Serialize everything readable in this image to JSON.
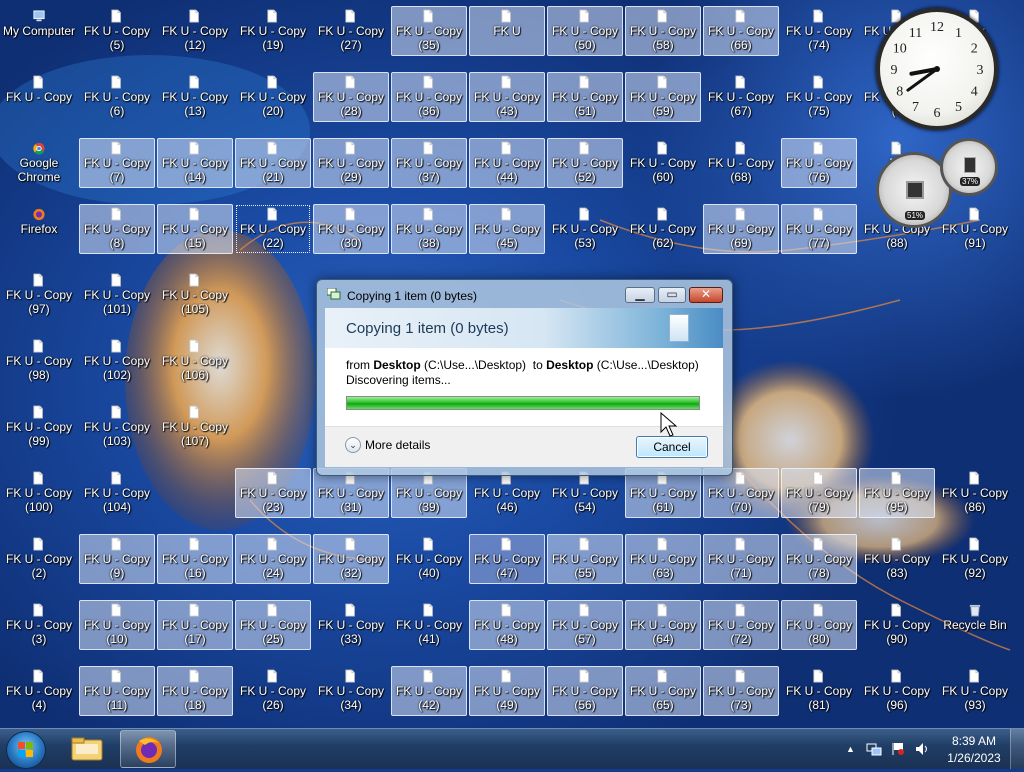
{
  "desktop": {
    "icon_type_names": {
      "computer": "computer-icon",
      "browser-chrome": "chrome-icon",
      "browser-firefox": "firefox-icon",
      "file": "file-icon",
      "bin": "recycle-bin-icon"
    },
    "columns": [
      {
        "items": [
          {
            "label": "My Computer",
            "type": "computer"
          },
          {
            "label": "FK U - Copy",
            "type": "file"
          },
          {
            "label": "Google Chrome",
            "type": "browser-chrome"
          },
          {
            "label": "Firefox",
            "type": "browser-firefox"
          },
          {
            "label": "FK U - Copy (97)",
            "type": "file"
          },
          {
            "label": "FK U - Copy (98)",
            "type": "file"
          },
          {
            "label": "FK U - Copy (99)",
            "type": "file"
          },
          {
            "label": "FK U - Copy (100)",
            "type": "file"
          },
          {
            "label": "FK U - Copy (2)",
            "type": "file"
          },
          {
            "label": "FK U - Copy (3)",
            "type": "file"
          },
          {
            "label": "FK U - Copy (4)",
            "type": "file"
          }
        ]
      },
      {
        "items": [
          {
            "label": "FK U - Copy (5)",
            "type": "file"
          },
          {
            "label": "FK U - Copy (6)",
            "type": "file"
          },
          {
            "label": "FK U - Copy (7)",
            "type": "file",
            "sel": true
          },
          {
            "label": "FK U - Copy (8)",
            "type": "file",
            "sel": true
          },
          {
            "label": "FK U - Copy (101)",
            "type": "file"
          },
          {
            "label": "FK U - Copy (102)",
            "type": "file"
          },
          {
            "label": "FK U - Copy (103)",
            "type": "file"
          },
          {
            "label": "FK U - Copy (104)",
            "type": "file"
          },
          {
            "label": "FK U - Copy (9)",
            "type": "file",
            "sel": true
          },
          {
            "label": "FK U - Copy (10)",
            "type": "file",
            "sel": true
          },
          {
            "label": "FK U - Copy (11)",
            "type": "file",
            "sel": true
          }
        ]
      },
      {
        "items": [
          {
            "label": "FK U - Copy (12)",
            "type": "file"
          },
          {
            "label": "FK U - Copy (13)",
            "type": "file"
          },
          {
            "label": "FK U - Copy (14)",
            "type": "file",
            "sel": true
          },
          {
            "label": "FK U - Copy (15)",
            "type": "file",
            "sel": true
          },
          {
            "label": "FK U - Copy (105)",
            "type": "file"
          },
          {
            "label": "FK U - Copy (106)",
            "type": "file"
          },
          {
            "label": "FK U - Copy (107)",
            "type": "file"
          },
          {
            "label": "",
            "type": "none"
          },
          {
            "label": "FK U - Copy (16)",
            "type": "file",
            "sel": true
          },
          {
            "label": "FK U - Copy (17)",
            "type": "file",
            "sel": true
          },
          {
            "label": "FK U - Copy (18)",
            "type": "file",
            "sel": true
          }
        ]
      },
      {
        "items": [
          {
            "label": "FK U - Copy (19)",
            "type": "file"
          },
          {
            "label": "FK U - Copy (20)",
            "type": "file"
          },
          {
            "label": "FK U - Copy (21)",
            "type": "file",
            "sel": true
          },
          {
            "label": "FK U - Copy (22)",
            "type": "file",
            "focus": true
          },
          {
            "label": "",
            "type": "none"
          },
          {
            "label": "",
            "type": "none"
          },
          {
            "label": "",
            "type": "none"
          },
          {
            "label": "FK U - Copy (23)",
            "type": "file",
            "sel": true
          },
          {
            "label": "FK U - Copy (24)",
            "type": "file",
            "sel": true
          },
          {
            "label": "FK U - Copy (25)",
            "type": "file",
            "sel": true
          },
          {
            "label": "FK U - Copy (26)",
            "type": "file"
          }
        ]
      },
      {
        "items": [
          {
            "label": "FK U - Copy (27)",
            "type": "file"
          },
          {
            "label": "FK U - Copy (28)",
            "type": "file",
            "sel": true
          },
          {
            "label": "FK U - Copy (29)",
            "type": "file",
            "sel": true
          },
          {
            "label": "FK U - Copy (30)",
            "type": "file",
            "sel": true
          },
          {
            "label": "",
            "type": "none"
          },
          {
            "label": "",
            "type": "none"
          },
          {
            "label": "",
            "type": "none"
          },
          {
            "label": "FK U - Copy (31)",
            "type": "file",
            "sel": true
          },
          {
            "label": "FK U - Copy (32)",
            "type": "file",
            "sel": true
          },
          {
            "label": "FK U - Copy (33)",
            "type": "file"
          },
          {
            "label": "FK U - Copy (34)",
            "type": "file"
          }
        ]
      },
      {
        "items": [
          {
            "label": "FK U - Copy (35)",
            "type": "file",
            "sel": true
          },
          {
            "label": "FK U - Copy (36)",
            "type": "file",
            "sel": true
          },
          {
            "label": "FK U - Copy (37)",
            "type": "file",
            "sel": true
          },
          {
            "label": "FK U - Copy (38)",
            "type": "file",
            "sel": true
          },
          {
            "label": "",
            "type": "none"
          },
          {
            "label": "",
            "type": "none"
          },
          {
            "label": "",
            "type": "none"
          },
          {
            "label": "FK U - Copy (39)",
            "type": "file",
            "sel": true
          },
          {
            "label": "FK U - Copy (40)",
            "type": "file"
          },
          {
            "label": "FK U - Copy (41)",
            "type": "file"
          },
          {
            "label": "FK U - Copy (42)",
            "type": "file",
            "sel": true
          }
        ]
      },
      {
        "items": [
          {
            "label": "FK U",
            "type": "file",
            "sel": true
          },
          {
            "label": "FK U - Copy (43)",
            "type": "file",
            "sel": true
          },
          {
            "label": "FK U - Copy (44)",
            "type": "file",
            "sel": true
          },
          {
            "label": "FK U - Copy (45)",
            "type": "file",
            "sel": true
          },
          {
            "label": "",
            "type": "none"
          },
          {
            "label": "",
            "type": "none"
          },
          {
            "label": "",
            "type": "none"
          },
          {
            "label": "FK U - Copy (46)",
            "type": "file"
          },
          {
            "label": "FK U - Copy (47)",
            "type": "file",
            "hl": true
          },
          {
            "label": "FK U - Copy (48)",
            "type": "file",
            "sel": true
          },
          {
            "label": "FK U - Copy (49)",
            "type": "file",
            "sel": true
          }
        ]
      },
      {
        "items": [
          {
            "label": "FK U - Copy (50)",
            "type": "file",
            "sel": true
          },
          {
            "label": "FK U - Copy (51)",
            "type": "file",
            "sel": true
          },
          {
            "label": "FK U - Copy (52)",
            "type": "file",
            "sel": true
          },
          {
            "label": "FK U - Copy (53)",
            "type": "file"
          },
          {
            "label": "",
            "type": "none"
          },
          {
            "label": "",
            "type": "none"
          },
          {
            "label": "",
            "type": "none"
          },
          {
            "label": "FK U - Copy (54)",
            "type": "file"
          },
          {
            "label": "FK U - Copy (55)",
            "type": "file",
            "sel": true
          },
          {
            "label": "FK U - Copy (57)",
            "type": "file",
            "sel": true
          },
          {
            "label": "FK U - Copy (56)",
            "type": "file",
            "sel": true
          }
        ]
      },
      {
        "items": [
          {
            "label": "FK U - Copy (58)",
            "type": "file",
            "sel": true
          },
          {
            "label": "FK U - Copy (59)",
            "type": "file",
            "sel": true
          },
          {
            "label": "FK U - Copy (60)",
            "type": "file"
          },
          {
            "label": "FK U - Copy (62)",
            "type": "file"
          },
          {
            "label": "",
            "type": "none"
          },
          {
            "label": "",
            "type": "none"
          },
          {
            "label": "",
            "type": "none"
          },
          {
            "label": "FK U - Copy (61)",
            "type": "file",
            "sel": true
          },
          {
            "label": "FK U - Copy (63)",
            "type": "file",
            "sel": true
          },
          {
            "label": "FK U - Copy (64)",
            "type": "file",
            "sel": true
          },
          {
            "label": "FK U - Copy (65)",
            "type": "file",
            "sel": true
          }
        ]
      },
      {
        "items": [
          {
            "label": "FK U - Copy (66)",
            "type": "file",
            "sel": true
          },
          {
            "label": "FK U - Copy (67)",
            "type": "file"
          },
          {
            "label": "FK U - Copy (68)",
            "type": "file"
          },
          {
            "label": "FK U - Copy (69)",
            "type": "file",
            "sel": true
          },
          {
            "label": "",
            "type": "none"
          },
          {
            "label": "",
            "type": "none"
          },
          {
            "label": "",
            "type": "none"
          },
          {
            "label": "FK U - Copy (70)",
            "type": "file",
            "sel": true
          },
          {
            "label": "FK U - Copy (71)",
            "type": "file",
            "sel": true
          },
          {
            "label": "FK U - Copy (72)",
            "type": "file",
            "sel": true
          },
          {
            "label": "FK U - Copy (73)",
            "type": "file",
            "sel": true
          }
        ]
      },
      {
        "items": [
          {
            "label": "FK U - Copy (74)",
            "type": "file"
          },
          {
            "label": "FK U - Copy (75)",
            "type": "file"
          },
          {
            "label": "FK U - Copy (76)",
            "type": "file",
            "sel": true
          },
          {
            "label": "FK U - Copy (77)",
            "type": "file",
            "sel": true
          },
          {
            "label": "",
            "type": "none"
          },
          {
            "label": "",
            "type": "none"
          },
          {
            "label": "",
            "type": "none"
          },
          {
            "label": "FK U - Copy (79)",
            "type": "file",
            "sel": true
          },
          {
            "label": "FK U - Copy (78)",
            "type": "file",
            "sel": true
          },
          {
            "label": "FK U - Copy (80)",
            "type": "file",
            "sel": true
          },
          {
            "label": "FK U - Copy (81)",
            "type": "file"
          }
        ]
      },
      {
        "items": [
          {
            "label": "FK U - Copy",
            "type": "file"
          },
          {
            "label": "FK U - Copy (9",
            "type": "file"
          },
          {
            "label": "FK",
            "type": "file"
          },
          {
            "label": "FK U - Copy (88)",
            "type": "file"
          },
          {
            "label": "",
            "type": "none"
          },
          {
            "label": "",
            "type": "none"
          },
          {
            "label": "",
            "type": "none"
          },
          {
            "label": "FK U - Copy (95)",
            "type": "file",
            "sel": true
          },
          {
            "label": "FK U - Copy (83)",
            "type": "file"
          },
          {
            "label": "FK U - Copy (90)",
            "type": "file"
          },
          {
            "label": "FK U - Copy (96)",
            "type": "file"
          }
        ]
      },
      {
        "items": [
          {
            "label": "opy",
            "type": "file"
          },
          {
            "label": "",
            "type": "none"
          },
          {
            "label": "",
            "type": "none"
          },
          {
            "label": "FK U - Copy (91)",
            "type": "file"
          },
          {
            "label": "",
            "type": "none"
          },
          {
            "label": "",
            "type": "none"
          },
          {
            "label": "",
            "type": "none"
          },
          {
            "label": "FK U - Copy (86)",
            "type": "file"
          },
          {
            "label": "FK U - Copy (92)",
            "type": "file"
          },
          {
            "label": "Recycle Bin",
            "type": "bin"
          },
          {
            "label": "FK U - Copy (93)",
            "type": "file"
          }
        ]
      }
    ]
  },
  "dialog": {
    "title": "Copying 1 item (0 bytes)",
    "heading": "Copying 1 item (0 bytes)",
    "from_prefix": "from",
    "from_name": "Desktop",
    "from_path": "(C:\\Use...\\Desktop)",
    "to_prefix": "to",
    "to_name": "Desktop",
    "to_path": "(C:\\Use...\\Desktop)",
    "status": "Discovering items...",
    "progress_fraction": 1.0,
    "more_details_label": "More details",
    "cancel_label": "Cancel",
    "minimize_glyph": "▁",
    "maximize_glyph": "▭",
    "close_glyph": "✕",
    "expand_glyph": "⌄"
  },
  "gadgets": {
    "clock": {
      "numbers": [
        "12",
        "1",
        "2",
        "3",
        "4",
        "5",
        "6",
        "7",
        "8",
        "9",
        "10",
        "11"
      ],
      "hour": 8.65,
      "minute": 39
    },
    "cpu_meter": {
      "value": "51%"
    },
    "ram_meter": {
      "value": "37%"
    }
  },
  "taskbar": {
    "start_icon": "windows-orb-icon",
    "pinned": [
      {
        "name": "explorer",
        "icon": "folder-icon"
      },
      {
        "name": "firefox",
        "icon": "firefox-icon",
        "active": true
      }
    ],
    "tray": {
      "show_hidden_glyph": "▲",
      "time": "8:39 AM",
      "date": "1/26/2023",
      "icons": [
        "network-icon",
        "flag-icon",
        "volume-icon"
      ]
    }
  },
  "colors": {
    "wallpaper": "#123d8f",
    "selection": "#d7e1f5",
    "progress": "#22b722"
  }
}
